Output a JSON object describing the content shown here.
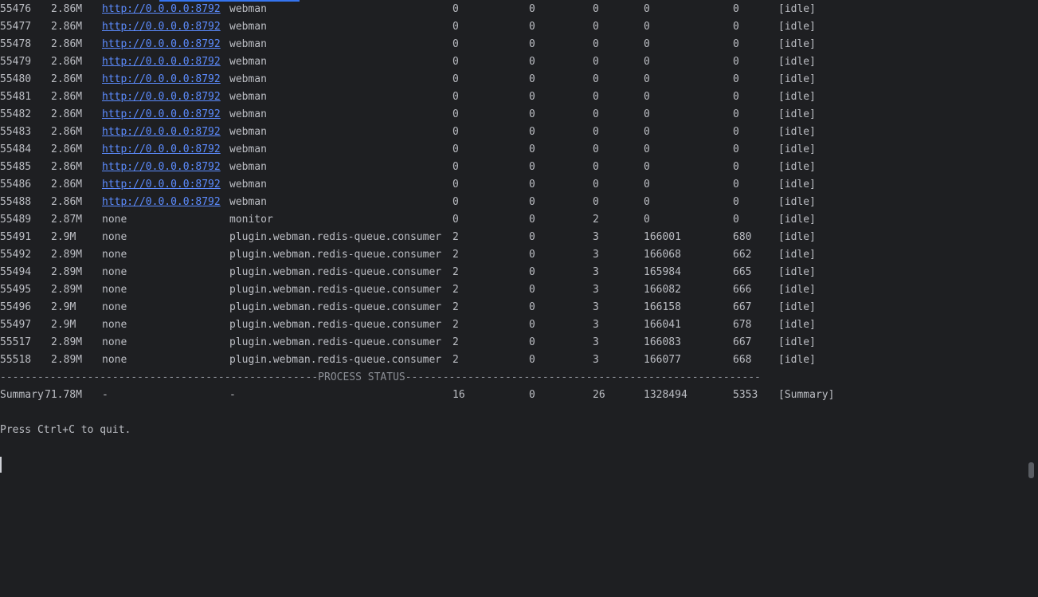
{
  "processes": [
    {
      "pid": "55476",
      "memory": "2.86M",
      "listening": "http://0.0.0.0:8792",
      "worker": "webman",
      "connections": "0",
      "send_fail": "0",
      "timers": "0",
      "total_request": "0",
      "qps": "0",
      "status": "[idle]"
    },
    {
      "pid": "55477",
      "memory": "2.86M",
      "listening": "http://0.0.0.0:8792",
      "worker": "webman",
      "connections": "0",
      "send_fail": "0",
      "timers": "0",
      "total_request": "0",
      "qps": "0",
      "status": "[idle]"
    },
    {
      "pid": "55478",
      "memory": "2.86M",
      "listening": "http://0.0.0.0:8792",
      "worker": "webman",
      "connections": "0",
      "send_fail": "0",
      "timers": "0",
      "total_request": "0",
      "qps": "0",
      "status": "[idle]"
    },
    {
      "pid": "55479",
      "memory": "2.86M",
      "listening": "http://0.0.0.0:8792",
      "worker": "webman",
      "connections": "0",
      "send_fail": "0",
      "timers": "0",
      "total_request": "0",
      "qps": "0",
      "status": "[idle]"
    },
    {
      "pid": "55480",
      "memory": "2.86M",
      "listening": "http://0.0.0.0:8792",
      "worker": "webman",
      "connections": "0",
      "send_fail": "0",
      "timers": "0",
      "total_request": "0",
      "qps": "0",
      "status": "[idle]"
    },
    {
      "pid": "55481",
      "memory": "2.86M",
      "listening": "http://0.0.0.0:8792",
      "worker": "webman",
      "connections": "0",
      "send_fail": "0",
      "timers": "0",
      "total_request": "0",
      "qps": "0",
      "status": "[idle]"
    },
    {
      "pid": "55482",
      "memory": "2.86M",
      "listening": "http://0.0.0.0:8792",
      "worker": "webman",
      "connections": "0",
      "send_fail": "0",
      "timers": "0",
      "total_request": "0",
      "qps": "0",
      "status": "[idle]"
    },
    {
      "pid": "55483",
      "memory": "2.86M",
      "listening": "http://0.0.0.0:8792",
      "worker": "webman",
      "connections": "0",
      "send_fail": "0",
      "timers": "0",
      "total_request": "0",
      "qps": "0",
      "status": "[idle]"
    },
    {
      "pid": "55484",
      "memory": "2.86M",
      "listening": "http://0.0.0.0:8792",
      "worker": "webman",
      "connections": "0",
      "send_fail": "0",
      "timers": "0",
      "total_request": "0",
      "qps": "0",
      "status": "[idle]"
    },
    {
      "pid": "55485",
      "memory": "2.86M",
      "listening": "http://0.0.0.0:8792",
      "worker": "webman",
      "connections": "0",
      "send_fail": "0",
      "timers": "0",
      "total_request": "0",
      "qps": "0",
      "status": "[idle]"
    },
    {
      "pid": "55486",
      "memory": "2.86M",
      "listening": "http://0.0.0.0:8792",
      "worker": "webman",
      "connections": "0",
      "send_fail": "0",
      "timers": "0",
      "total_request": "0",
      "qps": "0",
      "status": "[idle]"
    },
    {
      "pid": "55488",
      "memory": "2.86M",
      "listening": "http://0.0.0.0:8792",
      "worker": "webman",
      "connections": "0",
      "send_fail": "0",
      "timers": "0",
      "total_request": "0",
      "qps": "0",
      "status": "[idle]"
    },
    {
      "pid": "55489",
      "memory": "2.87M",
      "listening": "none",
      "worker": "monitor",
      "connections": "0",
      "send_fail": "0",
      "timers": "2",
      "total_request": "0",
      "qps": "0",
      "status": "[idle]"
    },
    {
      "pid": "55491",
      "memory": "2.9M",
      "listening": "none",
      "worker": "plugin.webman.redis-queue.consumer",
      "connections": "2",
      "send_fail": "0",
      "timers": "3",
      "total_request": "166001",
      "qps": "680",
      "status": "[idle]"
    },
    {
      "pid": "55492",
      "memory": "2.89M",
      "listening": "none",
      "worker": "plugin.webman.redis-queue.consumer",
      "connections": "2",
      "send_fail": "0",
      "timers": "3",
      "total_request": "166068",
      "qps": "662",
      "status": "[idle]"
    },
    {
      "pid": "55494",
      "memory": "2.89M",
      "listening": "none",
      "worker": "plugin.webman.redis-queue.consumer",
      "connections": "2",
      "send_fail": "0",
      "timers": "3",
      "total_request": "165984",
      "qps": "665",
      "status": "[idle]"
    },
    {
      "pid": "55495",
      "memory": "2.89M",
      "listening": "none",
      "worker": "plugin.webman.redis-queue.consumer",
      "connections": "2",
      "send_fail": "0",
      "timers": "3",
      "total_request": "166082",
      "qps": "666",
      "status": "[idle]"
    },
    {
      "pid": "55496",
      "memory": "2.9M",
      "listening": "none",
      "worker": "plugin.webman.redis-queue.consumer",
      "connections": "2",
      "send_fail": "0",
      "timers": "3",
      "total_request": "166158",
      "qps": "667",
      "status": "[idle]"
    },
    {
      "pid": "55497",
      "memory": "2.9M",
      "listening": "none",
      "worker": "plugin.webman.redis-queue.consumer",
      "connections": "2",
      "send_fail": "0",
      "timers": "3",
      "total_request": "166041",
      "qps": "678",
      "status": "[idle]"
    },
    {
      "pid": "55517",
      "memory": "2.89M",
      "listening": "none",
      "worker": "plugin.webman.redis-queue.consumer",
      "connections": "2",
      "send_fail": "0",
      "timers": "3",
      "total_request": "166083",
      "qps": "667",
      "status": "[idle]"
    },
    {
      "pid": "55518",
      "memory": "2.89M",
      "listening": "none",
      "worker": "plugin.webman.redis-queue.consumer",
      "connections": "2",
      "send_fail": "0",
      "timers": "3",
      "total_request": "166077",
      "qps": "668",
      "status": "[idle]"
    }
  ],
  "separator": "---------------------------------------------------PROCESS STATUS---------------------------------------------------------",
  "summary": {
    "pid": "Summary",
    "memory": "71.78M",
    "listening": "-",
    "worker": "-",
    "connections": "16",
    "send_fail": "0",
    "timers": "26",
    "total_request": "1328494",
    "qps": "5353",
    "status": "[Summary]"
  },
  "quit_message": "Press Ctrl+C to quit.",
  "colors": {
    "background": "#1e1f22",
    "text": "#bcbec4",
    "link": "#5c8cff"
  }
}
